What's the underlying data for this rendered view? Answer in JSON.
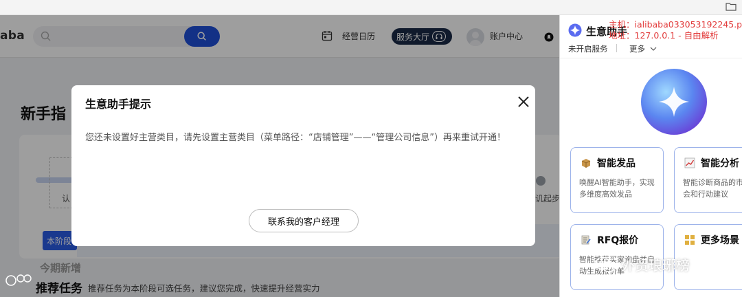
{
  "header": {
    "logo_text": "aba",
    "search": {
      "placeholder": ""
    },
    "nav": {
      "calendar": "经营日历",
      "service_hall": "服务大厅",
      "account": "账户中心"
    }
  },
  "page": {
    "title": "新手指",
    "step_left": "认",
    "step_right": "讥起步期",
    "stage_badge": "本阶段",
    "recommend_under": "今期新增",
    "recommend_title": "推荐任务",
    "recommend_desc": "推荐任务为本阶段可选任务，建议您完成，快速提升经营实力"
  },
  "modal": {
    "title": "生意助手提示",
    "body": "您还未设置好主营类目，请先设置主营类目（菜单路径：“店铺管理”——“管理公司信息”）再来重试开通！",
    "button": "联系我的客户经理"
  },
  "panel": {
    "title": "生意助手",
    "status": "未开启服务",
    "more": "更多",
    "cards": [
      {
        "title": "智能发品",
        "desc": "唤醒AI智能助手，实现多维度高效发品",
        "icon": "box-icon"
      },
      {
        "title": "智能分析",
        "desc": "智能诊断商品的市场机会和行动建议",
        "icon": "trend-chart-icon"
      },
      {
        "title": "RFQ报价",
        "desc": "智能推荐买家询盘并自动生成报价单",
        "icon": "quote-doc-icon"
      },
      {
        "title": "更多场景",
        "desc": "",
        "icon": "grid-icon"
      }
    ]
  },
  "debug": {
    "line1": "主机：ialibaba033053192245.p",
    "line2": "地址：127.0.0.1 - 自由解析"
  },
  "watermark": {
    "text": "外贸琅琊榜"
  },
  "colors": {
    "primary_blue": "#1f4fd9",
    "badge_blue": "#2b5ce6",
    "dark_navy": "#1a2a47",
    "debug_red": "#e23b3b",
    "card_border": "#9db3ea"
  }
}
